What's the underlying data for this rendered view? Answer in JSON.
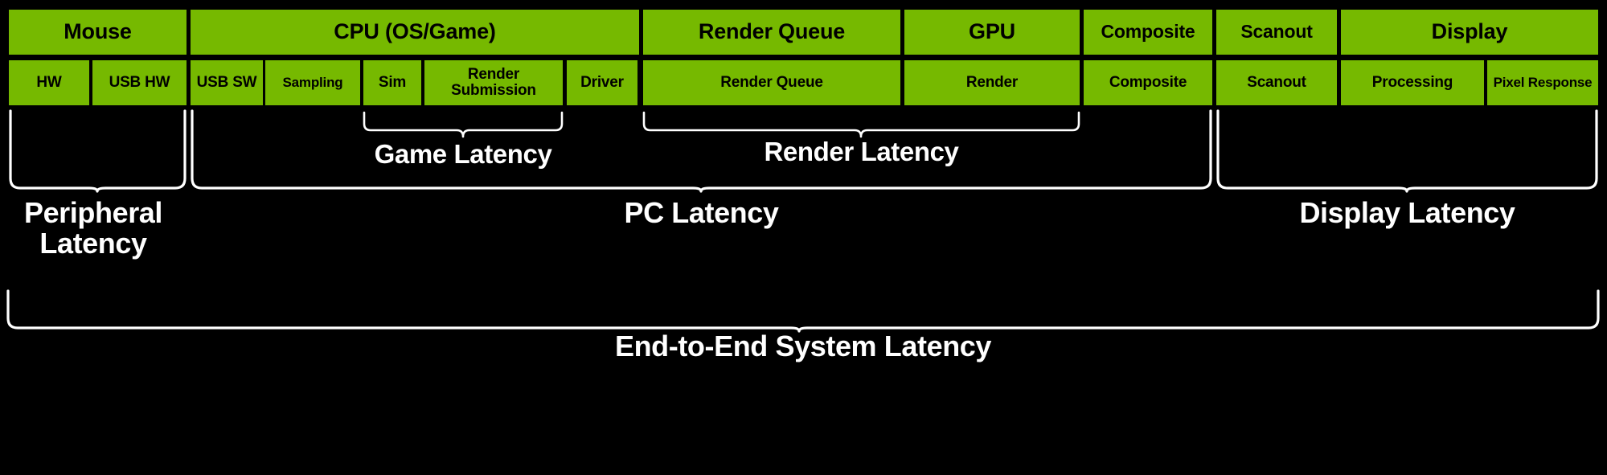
{
  "diagram": {
    "title": "End-to-End System Latency pipeline",
    "background_color": "#000000",
    "block_color": "#76b900",
    "block_text_color": "#000000",
    "bracket_color": "#ffffff"
  },
  "row1": [
    {
      "label": "Mouse"
    },
    {
      "label": "CPU (OS/Game)"
    },
    {
      "label": "Render Queue"
    },
    {
      "label": "GPU"
    },
    {
      "label": "Composite"
    },
    {
      "label": "Scanout"
    },
    {
      "label": "Display"
    }
  ],
  "row2": [
    {
      "label": "HW"
    },
    {
      "label": "USB\nHW"
    },
    {
      "label": "USB\nSW"
    },
    {
      "label": "Sampling"
    },
    {
      "label": "Sim"
    },
    {
      "label": "Render\nSubmission"
    },
    {
      "label": "Driver"
    },
    {
      "label": "Render Queue"
    },
    {
      "label": "Render"
    },
    {
      "label": "Composite"
    },
    {
      "label": "Scanout"
    },
    {
      "label": "Processing"
    },
    {
      "label": "Pixel\nResponse"
    }
  ],
  "brackets": {
    "game_latency": "Game Latency",
    "render_latency": "Render Latency",
    "peripheral_latency": "Peripheral\nLatency",
    "pc_latency": "PC Latency",
    "display_latency": "Display Latency",
    "end_to_end": "End-to-End System Latency"
  }
}
